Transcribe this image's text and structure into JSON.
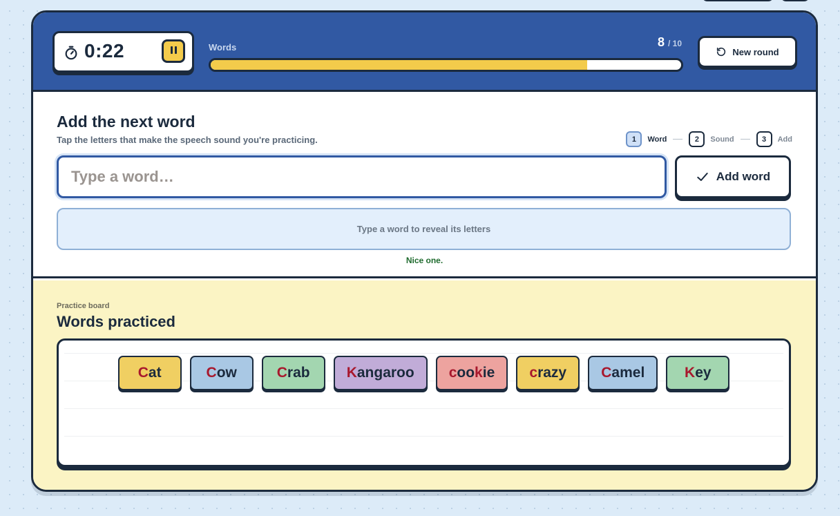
{
  "header": {
    "timer": {
      "value": "0:22",
      "icon": "stopwatch-icon",
      "pause_icon": "pause-icon"
    },
    "progress": {
      "label": "Words",
      "current": "8",
      "total": "/ 10",
      "fraction": 0.8
    },
    "new_round_label": "New round"
  },
  "compose": {
    "title": "Add the next word",
    "subtitle": "Tap the letters that make the speech sound you're practicing.",
    "steps": [
      {
        "num": "1",
        "label": "Word"
      },
      {
        "num": "2",
        "label": "Sound"
      },
      {
        "num": "3",
        "label": "Add"
      }
    ],
    "input_placeholder": "Type a word…",
    "add_word_label": "Add word",
    "letters_hint": "Type a word to reveal its letters",
    "feedback": "Nice one."
  },
  "board": {
    "eyebrow": "Practice board",
    "title": "Words practiced",
    "words": [
      {
        "pre": "",
        "hl": "C",
        "post": "at",
        "color": "#f0cf62"
      },
      {
        "pre": "",
        "hl": "C",
        "post": "ow",
        "color": "#a9c8e4"
      },
      {
        "pre": "",
        "hl": "C",
        "post": "rab",
        "color": "#a3d6b0"
      },
      {
        "pre": "",
        "hl": "K",
        "post": "angaroo",
        "color": "#c1acd8"
      },
      {
        "pre": "",
        "hl": "c",
        "post": "oo",
        "hl2": "k",
        "post2": "ie",
        "color": "#eda39f"
      },
      {
        "pre": "",
        "hl": "c",
        "post": "razy",
        "color": "#f0cf62"
      },
      {
        "pre": "",
        "hl": "C",
        "post": "amel",
        "color": "#a9c8e4"
      },
      {
        "pre": "",
        "hl": "K",
        "post": "ey",
        "color": "#a3d6b0"
      }
    ]
  },
  "colors": {
    "brand": "#3159a3",
    "accent": "#f3cb4b",
    "ink": "#1b2a3d",
    "highlight": "#a8182d",
    "board_bg": "#fbf4c4"
  }
}
